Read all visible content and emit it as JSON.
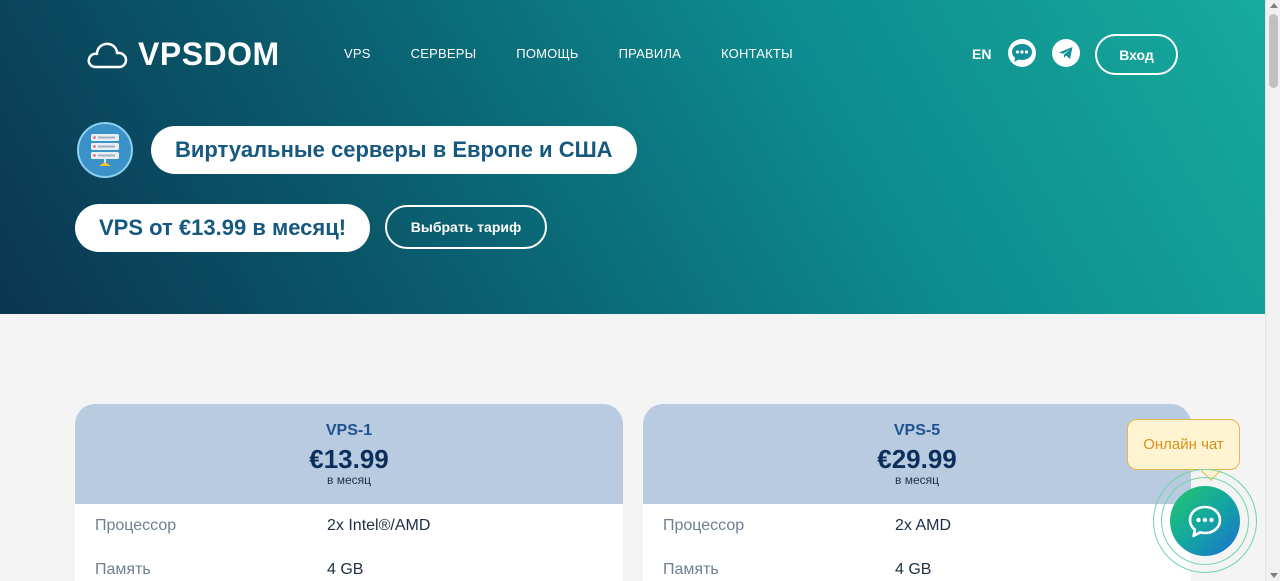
{
  "header": {
    "logo_text": "VPSDOM",
    "logo_icon": "cloud-icon",
    "nav": [
      "VPS",
      "СЕРВЕРЫ",
      "ПОМОЩЬ",
      "ПРАВИЛА",
      "КОНТАКТЫ"
    ],
    "lang": "EN",
    "login_label": "Вход"
  },
  "hero": {
    "title": "Виртуальные серверы в Европе и США",
    "price_line": "VPS от €13.99 в месяц!",
    "choose_label": "Выбрать тариф"
  },
  "plans": [
    {
      "name": "VPS-1",
      "price": "€13.99",
      "period": "в месяц",
      "specs": [
        {
          "label": "Процессор",
          "value": "2x Intel®/AMD"
        },
        {
          "label": "Память",
          "value": "4 GB"
        }
      ]
    },
    {
      "name": "VPS-5",
      "price": "€29.99",
      "period": "в месяц",
      "specs": [
        {
          "label": "Процессор",
          "value": "2x AMD"
        },
        {
          "label": "Память",
          "value": "4 GB"
        }
      ]
    }
  ],
  "chat": {
    "tooltip": "Онлайн чат"
  },
  "colors": {
    "hero_start": "#0b3550",
    "hero_end": "#16ab9c",
    "title_blue": "#16587f",
    "card_head": "#b8cbe0"
  }
}
